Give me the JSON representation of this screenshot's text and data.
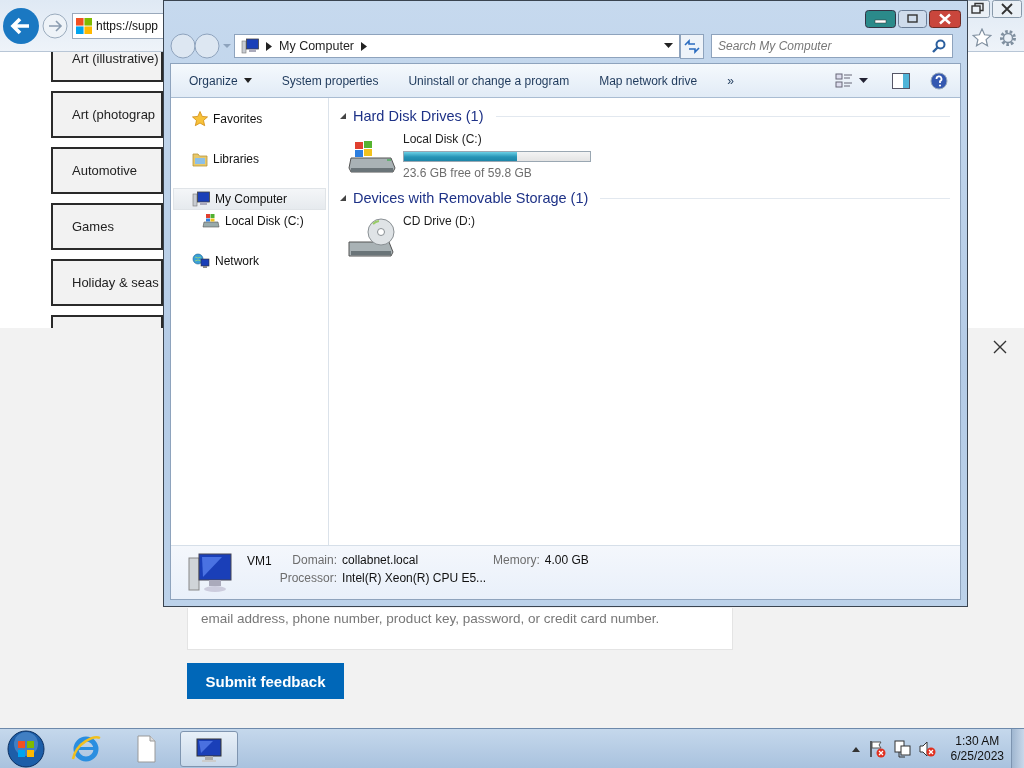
{
  "browser": {
    "address": "https://supp",
    "categories": [
      {
        "label": "Art (illustrative)"
      },
      {
        "label": "Art (photograp"
      },
      {
        "label": "Automotive"
      },
      {
        "label": "Games"
      },
      {
        "label": "Holiday & seas"
      }
    ],
    "feedback": {
      "hint_text": "email address, phone number, product key, password, or credit card number.",
      "submit": "Submit feedback"
    }
  },
  "explorer": {
    "breadcrumb": "My Computer",
    "search": {
      "placeholder": "Search My Computer"
    },
    "toolbar": [
      {
        "label": "Organize",
        "kind": "menu"
      },
      {
        "label": "System properties",
        "kind": "plain"
      },
      {
        "label": "Uninstall or change a program",
        "kind": "plain"
      },
      {
        "label": "Map network drive",
        "kind": "plain"
      },
      {
        "label": "»",
        "kind": "plain"
      }
    ],
    "nav": [
      {
        "label": "Favorites",
        "kind": "favorites",
        "selected": false
      },
      {
        "label": "Libraries",
        "kind": "libraries",
        "selected": false
      },
      {
        "label": "My Computer",
        "kind": "computer",
        "selected": true,
        "children": [
          {
            "label": "Local Disk (C:)",
            "kind": "disk",
            "selected": false
          }
        ]
      },
      {
        "label": "Network",
        "kind": "network",
        "selected": false
      }
    ],
    "groups": [
      {
        "title": "Hard Disk Drives (1)",
        "expanded": true,
        "items": [
          {
            "kind": "disk",
            "name": "Local Disk (C:)",
            "level": 0.61,
            "free": "23.6 GB free of 59.8 GB"
          }
        ]
      },
      {
        "title": "Devices with Removable Storage (1)",
        "expanded": true,
        "items": [
          {
            "kind": "cd",
            "name": "CD Drive (D:)"
          }
        ]
      }
    ],
    "details": {
      "name": "VM1",
      "fields": [
        {
          "label": "Domain:",
          "value": "collabnet.local"
        },
        {
          "label": "Memory:",
          "value": "4.00 GB"
        },
        {
          "label": "Processor:",
          "value": "Intel(R) Xeon(R) CPU E5..."
        }
      ]
    }
  },
  "taskbar": {
    "buttons": [
      {
        "kind": "ie",
        "selected": false
      },
      {
        "kind": "file",
        "selected": false
      },
      {
        "kind": "computer",
        "selected": true
      }
    ],
    "clock": {
      "time": "1:30 AM",
      "date": "6/25/2023"
    }
  }
}
